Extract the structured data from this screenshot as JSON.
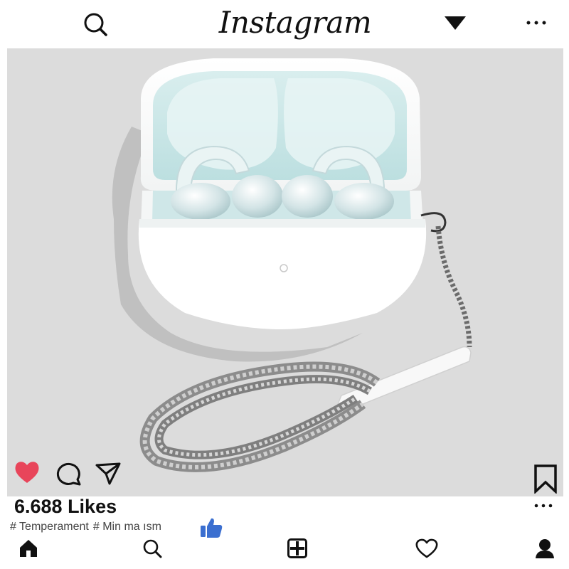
{
  "header": {
    "logo_text": "Instagram",
    "icons": [
      "search-icon",
      "dropdown-triangle-icon",
      "more-dots-icon"
    ]
  },
  "post": {
    "likes_text": "6.688 Likes",
    "hashtags": [
      "# Temperament",
      "# Min ma ısm"
    ],
    "liked": true,
    "colors": {
      "like": "#e8455a",
      "thumb": "#3b6fd0",
      "photo_bg": "#dcdcdc"
    },
    "icons": [
      "heart-icon",
      "comment-icon",
      "share-icon",
      "bookmark-icon",
      "thumbs-up-icon",
      "more-dots-icon"
    ]
  },
  "bottom_nav": {
    "items": [
      "home-icon",
      "search-icon",
      "add-post-icon",
      "heart-icon",
      "profile-icon"
    ]
  }
}
